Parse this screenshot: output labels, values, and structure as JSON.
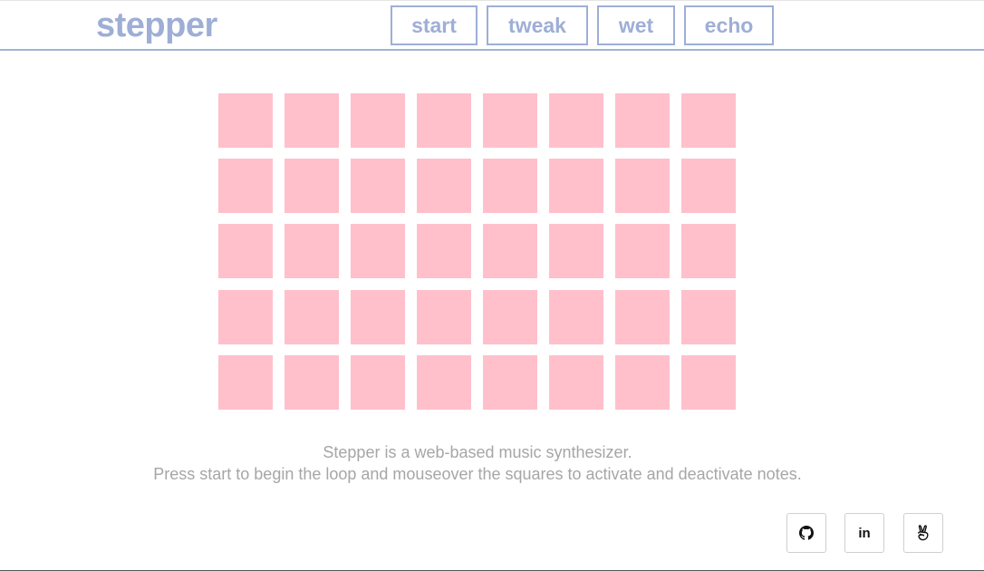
{
  "app": {
    "logo": "stepper"
  },
  "nav": {
    "buttons": [
      {
        "id": "start",
        "label": "start"
      },
      {
        "id": "tweak",
        "label": "tweak"
      },
      {
        "id": "wet",
        "label": "wet"
      },
      {
        "id": "echo",
        "label": "echo"
      }
    ]
  },
  "grid": {
    "rows": 5,
    "cols": 8,
    "cell_color": "#ffc0cb",
    "active": []
  },
  "description": {
    "line1": "Stepper is a web-based music synthesizer.",
    "line2": "Press start to begin the loop and mouseover the squares to activate and deactivate notes."
  },
  "social": {
    "links": [
      {
        "id": "github",
        "icon": "github-icon"
      },
      {
        "id": "linkedin",
        "icon": "linkedin-icon",
        "label": "in"
      },
      {
        "id": "angellist",
        "icon": "angellist-icon"
      }
    ]
  },
  "colors": {
    "accent": "#9eaed6",
    "cell": "#ffc0cb",
    "text": "#a6a6a6"
  }
}
